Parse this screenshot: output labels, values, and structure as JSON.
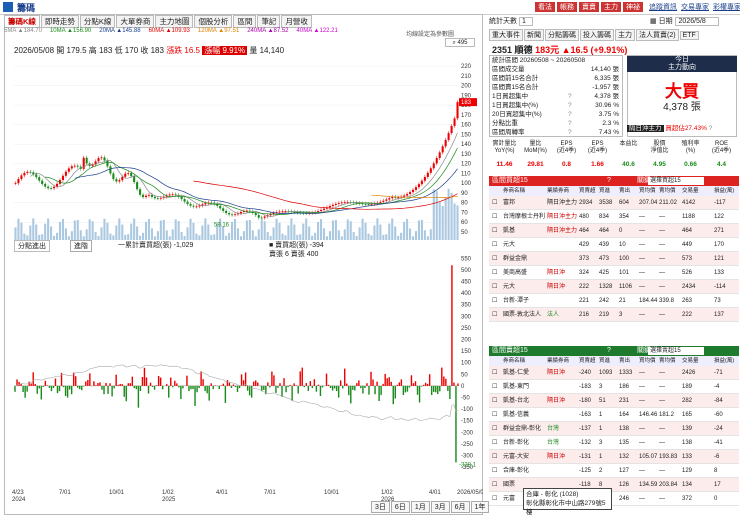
{
  "window": {
    "title": "籌碼"
  },
  "tabs": [
    "籌碼K線",
    "即時走勢",
    "分點K線",
    "大單券商",
    "主力地圖",
    "個股分析",
    "區間",
    "筆記",
    "月營收"
  ],
  "tab_active_index": 0,
  "ma_legend": [
    "5MA ▲184.70",
    "10MA ▲156.90",
    "20MA ▲145.88",
    "60MA ▲109.93",
    "120MA ▲97.51",
    "240MA ▲87.52",
    "40MA ▲122.21"
  ],
  "ma_note": "均線設定為參數圖",
  "price_info": {
    "date": "2026/05/08",
    "open_label": "開 179.5",
    "high_label": "高 183",
    "low_label": "低 170",
    "close_label": "收 183",
    "change_label": "漲跌 16.5",
    "pct_label": "漲幅 9.91%",
    "vol_label": "量 14,140"
  },
  "sub_header": {
    "selector": "分點進出",
    "btn": "進階",
    "line1": "一累計賣買超(張) -1,029",
    "line2": "■ 賣買超(張) -394",
    "line3": "賣張 6 賣張 400"
  },
  "price_axis": [
    "220",
    "210",
    "200",
    "190",
    "180",
    "170",
    "160",
    "150",
    "140",
    "130",
    "120",
    "110",
    "100",
    "90",
    "80",
    "70",
    "60",
    "50"
  ],
  "price_min_label": "59.16",
  "price_high_label": "183",
  "sub_axis": [
    "550",
    "500",
    "450",
    "400",
    "350",
    "300",
    "250",
    "200",
    "150",
    "100",
    "50",
    "0",
    "-50",
    "-100",
    "-150",
    "-200",
    "-250",
    "-300",
    "-350"
  ],
  "sub_last_label": "-338.1",
  "x_axis": [
    {
      "l1": "4/23",
      "l2": "2024"
    },
    {
      "l1": "7/01",
      "l2": ""
    },
    {
      "l1": "10/01",
      "l2": ""
    },
    {
      "l1": "1/02",
      "l2": "2025"
    },
    {
      "l1": "4/01",
      "l2": ""
    },
    {
      "l1": "7/01",
      "l2": ""
    },
    {
      "l1": "10/01",
      "l2": ""
    },
    {
      "l1": "1/02",
      "l2": "2026"
    },
    {
      "l1": "4/01",
      "l2": ""
    },
    {
      "l1": "2026/05/08",
      "l2": ""
    }
  ],
  "periods": [
    "3日",
    "6日",
    "1月",
    "3月",
    "6月",
    "1年"
  ],
  "right_top": {
    "buttons": [
      "看法",
      "帳務",
      "賣賣",
      "主力",
      "神祕"
    ],
    "links": [
      "追蹤資訊",
      "交易專家",
      "彩權專家"
    ]
  },
  "selector": {
    "label": "統計天數",
    "value": "1"
  },
  "date_box": {
    "label": "日期",
    "value": "2026/5/8"
  },
  "right_tabs": [
    "重大事件",
    "新聞",
    "分點籌碼",
    "投入籌碼",
    "主力",
    "法人買賣(2)",
    "ETF"
  ],
  "stock": {
    "id": "2351",
    "name": "順德",
    "price": "183元",
    "change": "▲16.5 (+9.91%)"
  },
  "stats": {
    "range": "統計區間  20260508 ~ 20260508",
    "rows": [
      {
        "k": "區間成交量",
        "v": "14,140 張",
        "q": ""
      },
      {
        "k": "區間前15名合計",
        "v": "6,335 張",
        "q": ""
      },
      {
        "k": "區間賣15名合計",
        "v": "-1,957 張",
        "q": ""
      },
      {
        "k": "1日買超集中",
        "v": "4,378 張",
        "q": "?"
      },
      {
        "k": "1日買超集中(%)",
        "v": "30.96 %",
        "q": "?"
      },
      {
        "k": "20日買超集中(%)",
        "v": "3.75 %",
        "q": "?"
      },
      {
        "k": "分點比重",
        "v": "2.3 %",
        "q": "?"
      },
      {
        "k": "區間周轉率",
        "v": "7.43 %",
        "q": "?"
      }
    ]
  },
  "main_force": {
    "title1": "今日",
    "title2": "主力動向",
    "big": "大買",
    "value": "4,378 張",
    "foot_badge": "隔日沖主力",
    "foot_text": "買超佔27.43%",
    "q": "?"
  },
  "metrics": [
    {
      "l1": "實計量比",
      "l2": "YoY(%)",
      "v": "11.46",
      "c": "#e00"
    },
    {
      "l1": "量比",
      "l2": "MoM(%)",
      "v": "29.81",
      "c": "#e00"
    },
    {
      "l1": "EPS",
      "l2": "(近4季)",
      "v": "0.8",
      "c": "#e00"
    },
    {
      "l1": "EPS",
      "l2": "(近4季)",
      "v": "1.66",
      "c": "#e00"
    },
    {
      "l1": "本益比",
      "l2": "",
      "v": "40.6",
      "c": "#1a8a1a"
    },
    {
      "l1": "股價",
      "l2": "淨值比",
      "v": "4.95",
      "c": "#1a8a1a"
    },
    {
      "l1": "殖利率",
      "l2": "(%)",
      "v": "0.66",
      "c": "#1a8a1a"
    },
    {
      "l1": "ROE",
      "l2": "(近4季)",
      "v": "4.4",
      "c": "#1a8a1a"
    }
  ],
  "buy_panel": {
    "title": "區間買超15",
    "q": "?",
    "sel_label": "關鍵券商：",
    "sel_value": "選擇買超15"
  },
  "sell_panel": {
    "title": "區間賣超15",
    "q": "?",
    "sel_label": "關鍵券商：",
    "sel_value": "選擇賣超15"
  },
  "col_headers": [
    "券商名稱",
    "業績券商",
    "買賣超",
    "買進",
    "賣出",
    "買均價",
    "賣均價",
    "交易量",
    "損益(萬)"
  ],
  "buy_rows": [
    {
      "name": "富邦",
      "tag": "隔日沖主力",
      "tagc": "",
      "net": "2934",
      "buy": "3538",
      "sell": "604",
      "bp": "207.04",
      "sp": "211.02",
      "vol": "4142",
      "pl": "-117"
    },
    {
      "name": "台灣摩根士丹利",
      "tag": "隔日沖主力",
      "tagc": "tag",
      "net": "480",
      "buy": "834",
      "sell": "354",
      "bp": "—",
      "sp": "—",
      "vol": "1188",
      "pl": "122"
    },
    {
      "name": "凱基",
      "tag": "隔日沖主力",
      "tagc": "tag",
      "net": "464",
      "buy": "464",
      "sell": "0",
      "bp": "—",
      "sp": "—",
      "vol": "464",
      "pl": "271"
    },
    {
      "name": "元大",
      "tag": "",
      "tagc": "",
      "net": "429",
      "buy": "439",
      "sell": "10",
      "bp": "—",
      "sp": "—",
      "vol": "449",
      "pl": "170"
    },
    {
      "name": "群益金鼎",
      "tag": "",
      "tagc": "",
      "net": "373",
      "buy": "473",
      "sell": "100",
      "bp": "—",
      "sp": "—",
      "vol": "573",
      "pl": "121"
    },
    {
      "name": "美商高盛",
      "tag": "隔日沖",
      "tagc": "tag",
      "net": "324",
      "buy": "425",
      "sell": "101",
      "bp": "—",
      "sp": "—",
      "vol": "526",
      "pl": "133"
    },
    {
      "name": "元大",
      "tag": "隔日沖",
      "tagc": "tag",
      "net": "222",
      "buy": "1328",
      "sell": "1106",
      "bp": "—",
      "sp": "—",
      "vol": "2434",
      "pl": "-114"
    },
    {
      "name": "台新-潭子",
      "tag": "",
      "tagc": "",
      "net": "221",
      "buy": "242",
      "sell": "21",
      "bp": "184.44",
      "sp": "339.8",
      "vol": "263",
      "pl": "73"
    },
    {
      "name": "國票-敦北法人",
      "tag": "法人",
      "tagc": "tag2",
      "net": "216",
      "buy": "219",
      "sell": "3",
      "bp": "—",
      "sp": "—",
      "vol": "222",
      "pl": "137"
    }
  ],
  "sell_rows": [
    {
      "name": "凱基-仁愛",
      "tag": "隔日沖",
      "tagc": "tag",
      "net": "-240",
      "buy": "1093",
      "sell": "1333",
      "bp": "—",
      "sp": "—",
      "vol": "2426",
      "pl": "-71"
    },
    {
      "name": "凱基-東門",
      "tag": "",
      "tagc": "",
      "net": "-183",
      "buy": "3",
      "sell": "186",
      "bp": "—",
      "sp": "—",
      "vol": "189",
      "pl": "-4"
    },
    {
      "name": "凱基-台北",
      "tag": "隔日沖",
      "tagc": "tag",
      "net": "-180",
      "buy": "51",
      "sell": "231",
      "bp": "—",
      "sp": "—",
      "vol": "282",
      "pl": "-84"
    },
    {
      "name": "凱基-信義",
      "tag": "",
      "tagc": "",
      "net": "-163",
      "buy": "1",
      "sell": "164",
      "bp": "146.46",
      "sp": "181.2",
      "vol": "165",
      "pl": "-60"
    },
    {
      "name": "群益金鼎-彰化",
      "tag": "台灣",
      "tagc": "tag2",
      "net": "-137",
      "buy": "1",
      "sell": "138",
      "bp": "—",
      "sp": "—",
      "vol": "139",
      "pl": "-24"
    },
    {
      "name": "台新-彰化",
      "tag": "台灣",
      "tagc": "tag2",
      "net": "-132",
      "buy": "3",
      "sell": "135",
      "bp": "—",
      "sp": "—",
      "vol": "138",
      "pl": "-41"
    },
    {
      "name": "元富-大安",
      "tag": "隔日沖",
      "tagc": "tag",
      "net": "-131",
      "buy": "1",
      "sell": "132",
      "bp": "105.07",
      "sp": "193.83",
      "vol": "133",
      "pl": "-6"
    },
    {
      "name": "合庫-彰化",
      "tag": "",
      "tagc": "",
      "net": "-125",
      "buy": "2",
      "sell": "127",
      "bp": "—",
      "sp": "—",
      "vol": "129",
      "pl": "8"
    },
    {
      "name": "國票",
      "tag": "",
      "tagc": "",
      "net": "-118",
      "buy": "8",
      "sell": "126",
      "bp": "134.59",
      "sp": "203.84",
      "vol": "134",
      "pl": "17"
    },
    {
      "name": "元富",
      "tag": "",
      "tagc": "",
      "net": "-115",
      "buy": "6",
      "sell": "246",
      "bp": "—",
      "sp": "—",
      "vol": "372",
      "pl": "0"
    }
  ],
  "tooltip": {
    "line1": "合庫 - 彰化 (1028)",
    "line2": "彰化縣彰化市中山路279號5樓"
  },
  "colors": {
    "up": "#e00000",
    "down": "#1a8a1a",
    "header_red": "#d22",
    "header_green": "#1e7b2e",
    "navy": "#1e2d4a"
  }
}
